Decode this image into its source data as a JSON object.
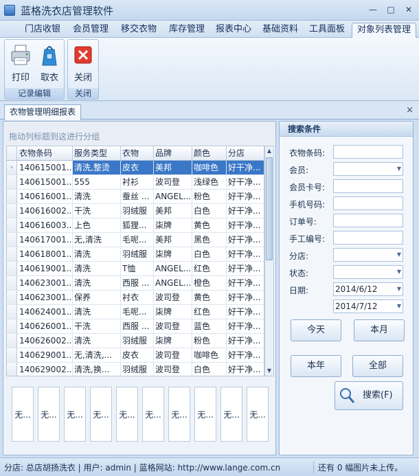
{
  "window": {
    "title": "蓝格洗衣店管理软件",
    "minimize": "—",
    "maximize": "□",
    "close": "✕"
  },
  "menu": {
    "tabs": [
      {
        "label": "门店收银"
      },
      {
        "label": "会员管理"
      },
      {
        "label": "移交衣物"
      },
      {
        "label": "库存管理"
      },
      {
        "label": "报表中心"
      },
      {
        "label": "基础资料"
      },
      {
        "label": "工具面板"
      },
      {
        "label": "对象列表管理"
      }
    ],
    "active_index": 7
  },
  "ribbon": {
    "groups": [
      {
        "label": "记录编辑",
        "buttons": [
          {
            "label": "打印",
            "icon": "printer-icon"
          },
          {
            "label": "取衣",
            "icon": "clothes-bag-icon"
          }
        ]
      },
      {
        "label": "关闭",
        "buttons": [
          {
            "label": "关闭",
            "icon": "close-red-icon"
          }
        ]
      }
    ]
  },
  "document": {
    "tab_label": "衣物管理明细报表",
    "close": "×"
  },
  "grid": {
    "group_hint": "拖动列标题到这进行分组",
    "indicator": "›",
    "columns": [
      "衣物条码",
      "服务类型",
      "衣物",
      "品牌",
      "颜色",
      "分店"
    ],
    "rows": [
      [
        "140615001...",
        "清洗,整烫",
        "皮衣",
        "美邦",
        "咖啡色",
        "好干净..."
      ],
      [
        "140615001...",
        "555",
        "衬衫",
        "波司登",
        "浅绿色",
        "好干净..."
      ],
      [
        "140616001...",
        "清洗",
        "蚕丝 ...",
        "ANGEL...",
        "粉色",
        "好干净..."
      ],
      [
        "140616002...",
        "干洗",
        "羽绒服",
        "美邦",
        "白色",
        "好干净..."
      ],
      [
        "140616003...",
        "上色",
        "狐狸...",
        "柒牌",
        "黄色",
        "好干净..."
      ],
      [
        "140617001...",
        "无,清洗",
        "毛呢...",
        "美邦",
        "黑色",
        "好干净..."
      ],
      [
        "140618001...",
        "清洗",
        "羽绒服",
        "柒牌",
        "白色",
        "好干净..."
      ],
      [
        "140619001...",
        "清洗",
        "T恤",
        "ANGEL...",
        "红色",
        "好干净..."
      ],
      [
        "140623001...",
        "清洗",
        "西服 ...",
        "ANGEL...",
        "橙色",
        "好干净..."
      ],
      [
        "140623001...",
        "保养",
        "衬衣",
        "波司登",
        "黄色",
        "好干净..."
      ],
      [
        "140624001...",
        "清洗",
        "毛呢...",
        "柒牌",
        "红色",
        "好干净..."
      ],
      [
        "140626001...",
        "干洗",
        "西服 ...",
        "波司登",
        "蓝色",
        "好干净..."
      ],
      [
        "140626002...",
        "清洗",
        "羽绒服",
        "柒牌",
        "粉色",
        "好干净..."
      ],
      [
        "140629001...",
        "无,清洗,...",
        "皮衣",
        "波司登",
        "咖啡色",
        "好干净..."
      ],
      [
        "140629002...",
        "清洗,换...",
        "羽绒服",
        "波司登",
        "白色",
        "好干净..."
      ]
    ],
    "selected_row": 0
  },
  "thumbnails": [
    "无...",
    "无...",
    "无...",
    "无...",
    "无...",
    "无...",
    "无...",
    "无...",
    "无...",
    "无..."
  ],
  "search": {
    "title": "搜索条件",
    "fields": [
      {
        "label": "衣物条码:",
        "type": "text",
        "value": ""
      },
      {
        "label": "会员:",
        "type": "combo",
        "value": ""
      },
      {
        "label": "会员卡号:",
        "type": "text",
        "value": ""
      },
      {
        "label": "手机号码:",
        "type": "text",
        "value": ""
      },
      {
        "label": "订单号:",
        "type": "text",
        "value": ""
      },
      {
        "label": "手工编号:",
        "type": "text",
        "value": ""
      },
      {
        "label": "分店:",
        "type": "combo",
        "value": ""
      },
      {
        "label": "状态:",
        "type": "combo",
        "value": ""
      },
      {
        "label": "日期:",
        "type": "combo",
        "value": "2014/6/12"
      },
      {
        "label": "",
        "type": "combo",
        "value": "2014/7/12"
      }
    ],
    "buttons": {
      "today": "今天",
      "month": "本月",
      "year": "本年",
      "all": "全部",
      "search": "搜索(F)"
    }
  },
  "status": {
    "left": "分店: 总店胡扬洗衣  | 用户: admin  |  蓝格网站: http://www.lange.com.cn",
    "right": "还有 0 幅图片未上传。"
  }
}
